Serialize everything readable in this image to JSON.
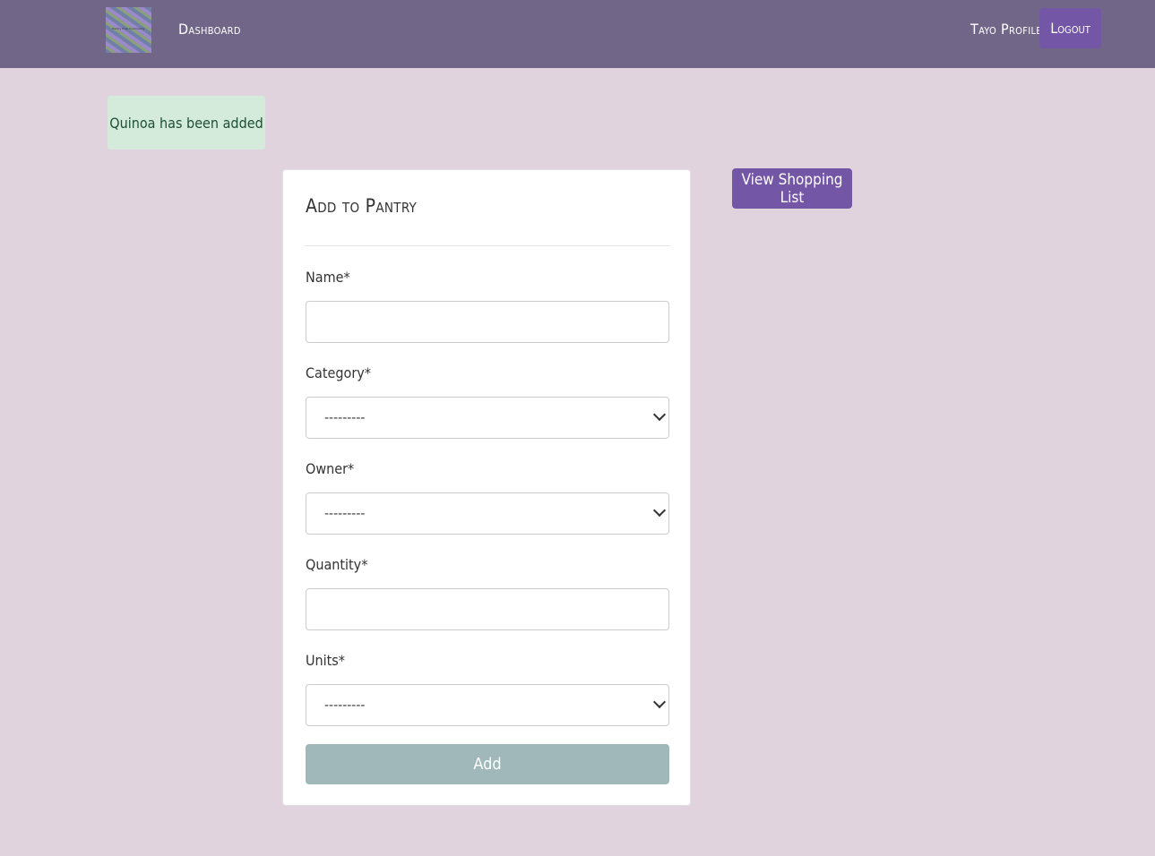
{
  "navbar": {
    "logo_text": "Pantry Prep Community",
    "dashboard_label": "Dashboard",
    "profile_label": "Tayo Profile",
    "logout_label": "Logout",
    "background_color": "#716688",
    "accent_color": "#7356a6"
  },
  "alert": {
    "message": "Quinoa has been added",
    "background_color": "#d4ebdc"
  },
  "form": {
    "title": "Add to Pantry",
    "fields": [
      {
        "label": "Name*",
        "type": "text",
        "value": ""
      },
      {
        "label": "Category*",
        "type": "select",
        "selected": "---------"
      },
      {
        "label": "Owner*",
        "type": "select",
        "selected": "---------"
      },
      {
        "label": "Quantity*",
        "type": "text",
        "value": ""
      },
      {
        "label": "Units*",
        "type": "select",
        "selected": "---------"
      }
    ],
    "submit_label": "Add",
    "submit_color": "#a0b8b9"
  },
  "shopping_list": {
    "button_label": "View Shopping List"
  },
  "page_background": "#e0d3dd"
}
